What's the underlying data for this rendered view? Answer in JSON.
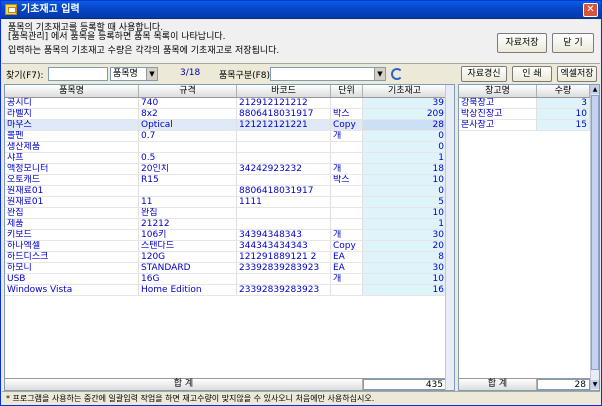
{
  "window": {
    "title": "기초재고 입력"
  },
  "info": {
    "line1": "품목의 기초재고를 등록할 때 사용합니다.",
    "line2": "[품목관리] 에서 품목을 등록하면 품목 목록이 나타납니다.",
    "line3": "입력하는 품목의 기초재고 수량은 각각의 품목에 기초재고로 저장됩니다.",
    "save_button": "자료저장",
    "close_button": "닫 기"
  },
  "toolbar": {
    "find_label": "찾기(F7):",
    "find_value": "",
    "find_field": "품목명",
    "count": "3/18",
    "category_label": "품목구분(F8)",
    "category_value": "",
    "refresh_button": "자료경신",
    "print_button": "인 쇄",
    "excel_button": "엑셀저장"
  },
  "items_table": {
    "columns": [
      "품목명",
      "규격",
      "바코드",
      "단위",
      "기초재고"
    ],
    "rows": [
      [
        "공시디",
        "740",
        "212912121212",
        "",
        "39"
      ],
      [
        "라벨지",
        "8x2",
        "8806418031917",
        "박스",
        "209"
      ],
      [
        "마우스",
        "Optical",
        "121212121221",
        "Copy",
        "28"
      ],
      [
        "볼펜",
        "0.7",
        "",
        "개",
        "0"
      ],
      [
        "생산제품",
        "",
        "",
        "",
        "0"
      ],
      [
        "샤프",
        "0.5",
        "",
        "",
        "1"
      ],
      [
        "액정모니터",
        "20인치",
        "34242923232",
        "개",
        "18"
      ],
      [
        "오토캐드",
        "R15",
        "",
        "박스",
        "10"
      ],
      [
        "원재료01",
        "",
        "8806418031917",
        "",
        "0"
      ],
      [
        "원재료01",
        "11",
        "1111",
        "",
        "5"
      ],
      [
        "완집",
        "완집",
        "",
        "",
        "10"
      ],
      [
        "제품",
        "21212",
        "",
        "",
        "1"
      ],
      [
        "키보드",
        "106키",
        "34394348343",
        "개",
        "30"
      ],
      [
        "하나엑셀",
        "스탠다드",
        "344343434343",
        "Copy",
        "20"
      ],
      [
        "하드디스크",
        "120G",
        "121291889121 2",
        "EA",
        "8"
      ],
      [
        "하모니",
        "STANDARD",
        "23392839283923",
        "EA",
        "30"
      ],
      [
        "USB",
        "16G",
        "",
        "개",
        "10"
      ],
      [
        "Windows Vista",
        "Home Edition",
        "23392839283923",
        "",
        "16"
      ]
    ],
    "selected_index": 2,
    "total_label": "합   계",
    "total_value": "435"
  },
  "warehouse_table": {
    "columns": [
      "창고명",
      "수량"
    ],
    "rows": [
      [
        "강북창고",
        "3"
      ],
      [
        "박상진창고",
        "10"
      ],
      [
        "본사창고",
        "15"
      ]
    ],
    "total_label": "합   계",
    "total_value": "28"
  },
  "status": {
    "message": "* 프로그램을 사용하는 중간에 일괄입력 작업을 하면 재고수량이 맞지않을 수 있사오니 처음에만 사용하십시오."
  }
}
